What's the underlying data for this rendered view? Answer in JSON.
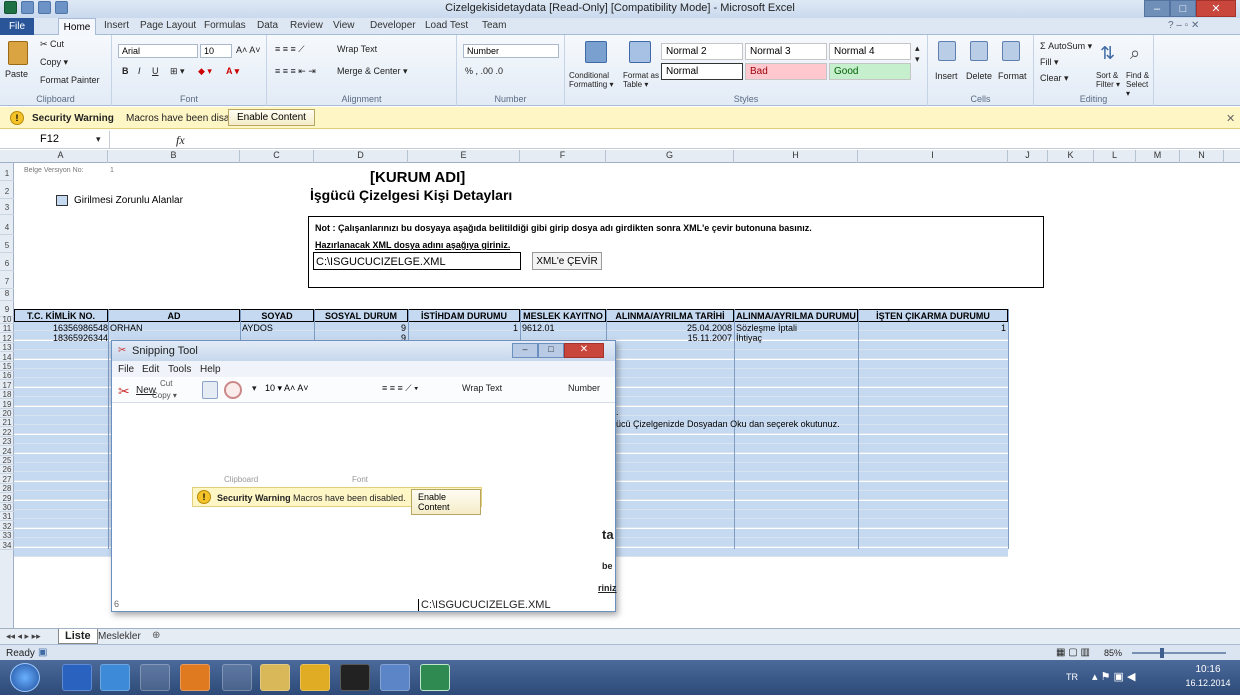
{
  "window": {
    "title": "Cizelgekisidetaydata  [Read-Only]  [Compatibility Mode]  -  Microsoft Excel",
    "controls": [
      "–",
      "□",
      "✕"
    ]
  },
  "ribbon_tabs": {
    "file": "File",
    "items": [
      "Home",
      "Insert",
      "Page Layout",
      "Formulas",
      "Data",
      "Review",
      "View",
      "Developer",
      "Load Test",
      "Team"
    ]
  },
  "clipboard": {
    "paste": "Paste",
    "cut": "Cut",
    "copy": "Copy ▾",
    "format_painter": "Format Painter",
    "label": "Clipboard"
  },
  "font": {
    "name": "Arial",
    "size": "10",
    "label": "Font"
  },
  "alignment": {
    "wrap": "Wrap Text",
    "merge": "Merge & Center ▾",
    "label": "Alignment"
  },
  "number": {
    "format": "Number",
    "label": "Number",
    "symbols": "% , .00 .0"
  },
  "styles": {
    "conditional": "Conditional Formatting ▾",
    "format_as_table": "Format as Table ▾",
    "cells": [
      {
        "label": "Normal 2",
        "bg": "#ffffff",
        "color": "#000000"
      },
      {
        "label": "Normal 3",
        "bg": "#ffffff",
        "color": "#000000"
      },
      {
        "label": "Normal 4",
        "bg": "#ffffff",
        "color": "#000000"
      },
      {
        "label": "Normal",
        "bg": "#ffffff",
        "color": "#000000"
      },
      {
        "label": "Bad",
        "bg": "#ffc7ce",
        "color": "#9c0006"
      },
      {
        "label": "Good",
        "bg": "#c6efce",
        "color": "#006100"
      }
    ],
    "label": "Styles"
  },
  "cells_group": {
    "insert": "Insert",
    "delete": "Delete",
    "format": "Format",
    "label": "Cells"
  },
  "editing": {
    "autosum": "Σ AutoSum ▾",
    "fill": "Fill ▾",
    "clear": "Clear ▾",
    "sort": "Sort & Filter ▾",
    "find": "Find & Select ▾",
    "label": "Editing"
  },
  "security_bar": {
    "title": "Security Warning",
    "message": "Macros have been disabled.",
    "button": "Enable Content"
  },
  "formula_bar": {
    "cell": "F12",
    "fx": "fx",
    "value": ""
  },
  "columns": [
    "A",
    "B",
    "C",
    "D",
    "E",
    "F",
    "G",
    "H",
    "I",
    "J",
    "K",
    "L",
    "M",
    "N"
  ],
  "rows": [
    "1",
    "2",
    "3",
    "4",
    "5",
    "6",
    "7",
    "8",
    "9",
    "10",
    "11",
    "12",
    "13",
    "14",
    "15",
    "16",
    "17",
    "18",
    "19",
    "20",
    "21",
    "22",
    "23",
    "24",
    "25",
    "26",
    "27",
    "28",
    "29",
    "30",
    "31",
    "32",
    "33",
    "34"
  ],
  "sheet": {
    "version_label": "Belge Versiyon No:",
    "version_value": "1",
    "company": "[KURUM ADI]",
    "subtitle": "İşgücü Çizelgesi Kişi Detayları",
    "legend": "Girilmesi Zorunlu Alanlar",
    "note": "Not : Çalışanlarınızı bu dosyaya aşağıda belitildiği gibi girip dosya adı girdikten sonra XML'e çevir butonuna basınız.",
    "xml_label": "Hazırlanacak XML dosya adını aşağıya giriniz.",
    "xml_path": "C:\\ISGUCUCIZELGE.XML",
    "convert_button": "XML'e ÇEVİR",
    "headers": [
      "T.C. KİMLİK NO.",
      "AD",
      "SOYAD",
      "SOSYAL DURUM",
      "İSTİHDAM DURUMU",
      "MESLEK KAYITNO",
      "ALINMA/AYRILMA  TARİHİ",
      "ALINMA/AYRILMA DURUMU",
      "İŞTEN ÇIKARMA DURUMU"
    ],
    "data_rows": [
      [
        "16356986548",
        "ORHAN",
        "AYDOS",
        "9",
        "1",
        "9612.01",
        "25.04.2008",
        "Sözleşme İptali",
        "1"
      ],
      [
        "18365926344",
        "",
        "",
        "9",
        "",
        "",
        "15.11.2007",
        "İhtiyaç",
        ""
      ]
    ],
    "partial_texts": [
      "nız.",
      "İşgücü Çizelgenizde Dosyadan Oku dan seçerek okutunuz.",
      "um"
    ]
  },
  "snipping_tool": {
    "title": "Snipping Tool",
    "menu": [
      "File",
      "Edit",
      "Tools",
      "Help"
    ],
    "new": "New",
    "cut": "Cut",
    "copy": "Copy ▾",
    "font_size": "10",
    "wrap": "Wrap Text",
    "number": "Number",
    "pct": "%",
    "clip_labels": [
      "Clipboard",
      "Font"
    ],
    "warn_title": "Security Warning",
    "warn_msg": "Macros have been disabled.",
    "warn_btn": "Enable Content",
    "path": "C:\\ISGUCUCIZELGE.XML",
    "row_num": "6",
    "edge_texts": [
      "ta",
      "be",
      "riniz"
    ]
  },
  "sheet_tabs": {
    "active": "Liste",
    "other": "Meslekler"
  },
  "status_bar": {
    "ready": "Ready",
    "zoom": "85%"
  },
  "taskbar": {
    "lang": "TR",
    "time": "10:16",
    "date": "16.12.2014"
  }
}
